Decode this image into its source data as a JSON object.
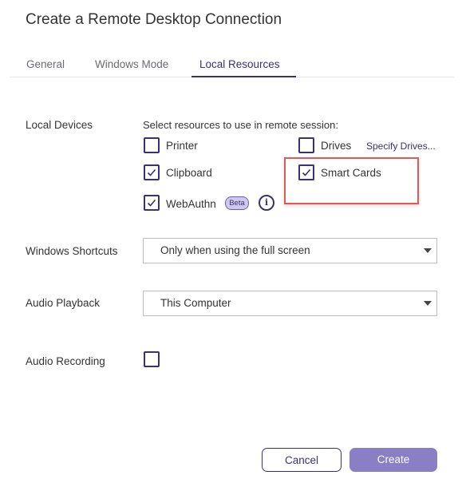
{
  "dialog": {
    "title": "Create a Remote Desktop Connection"
  },
  "tabs": [
    {
      "label": "General",
      "active": false
    },
    {
      "label": "Windows Mode",
      "active": false
    },
    {
      "label": "Local Resources",
      "active": true
    }
  ],
  "local_devices": {
    "label": "Local Devices",
    "hint": "Select resources to use in remote session:",
    "printer": {
      "label": "Printer",
      "checked": false
    },
    "drives": {
      "label": "Drives",
      "checked": false
    },
    "specify_drives_link": "Specify Drives...",
    "clipboard": {
      "label": "Clipboard",
      "checked": true
    },
    "smart_cards": {
      "label": "Smart Cards",
      "checked": true
    },
    "webauthn": {
      "label": "WebAuthn",
      "checked": true,
      "badge": "Beta",
      "info_glyph": "i"
    }
  },
  "windows_shortcuts": {
    "label": "Windows Shortcuts",
    "value": "Only when using the full screen"
  },
  "audio_playback": {
    "label": "Audio Playback",
    "value": "This Computer"
  },
  "audio_recording": {
    "label": "Audio Recording",
    "checked": false
  },
  "buttons": {
    "cancel": "Cancel",
    "create": "Create"
  },
  "colors": {
    "accent": "#3a3170",
    "primary_button": "#8a7fc4",
    "highlight": "#e05a55",
    "badge_bg": "#cfc8ee"
  }
}
